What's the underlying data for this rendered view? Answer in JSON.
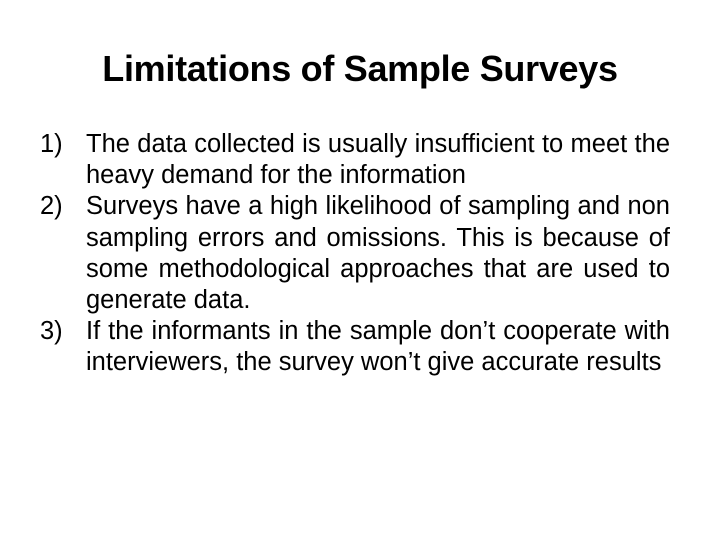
{
  "slide": {
    "title": "Limitations of Sample Surveys",
    "items": [
      {
        "number": "1)",
        "text": "The data collected is usually insufficient to meet the heavy demand for the information"
      },
      {
        "number": "2)",
        "text": "Surveys have a high likelihood of sampling and non sampling errors and omissions. This is because of some methodological approaches that are used to generate data."
      },
      {
        "number": "3)",
        "text": "If the informants in the sample don’t cooperate with interviewers, the survey won’t give accurate results"
      }
    ]
  }
}
